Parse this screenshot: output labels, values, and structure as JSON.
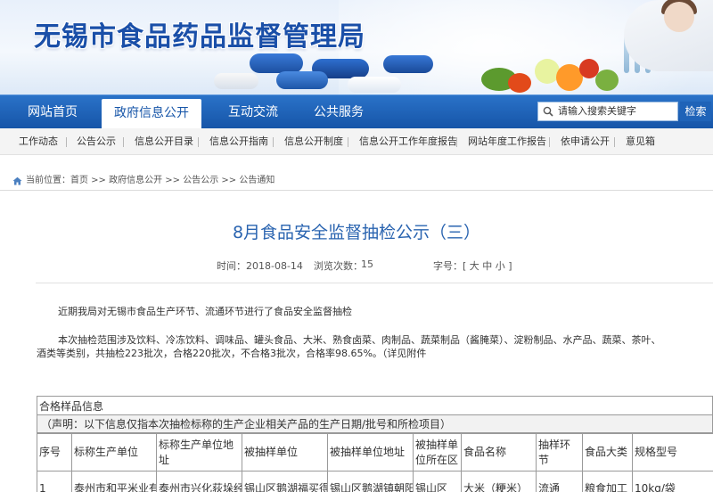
{
  "header": {
    "site_title": "无锡市食品药品监督管理局"
  },
  "nav": {
    "items": [
      "网站首页",
      "政府信息公开",
      "互动交流",
      "公共服务"
    ],
    "active_index": 1
  },
  "search": {
    "placeholder": "请输入搜索关键字",
    "button_label": "检索"
  },
  "subnav": {
    "items": [
      "工作动态",
      "公告公示",
      "信息公开目录",
      "信息公开指南",
      "信息公开制度",
      "信息公开工作年度报告",
      "网站年度工作报告",
      "依申请公开",
      "意见箱"
    ]
  },
  "breadcrumb": {
    "text": "当前位置：首页 >> 政府信息公开 >> 公告公示 >> 公告通知"
  },
  "article": {
    "title": "8月食品安全监督抽检公示（三）",
    "time_label": "时间：2018-08-14",
    "views_label": "浏览次数：",
    "views_value": "15",
    "font_label": "字号：[ 大 中 小 ]",
    "para1": "近期我局对无锡市食品生产环节、流通环节进行了食品安全监督抽检",
    "para2_line1": "本次抽检范围涉及饮料、冷冻饮料、调味品、罐头食品、大米、熟食卤菜、肉制品、蔬菜制品（酱腌菜）、淀粉制品、水产品、蔬菜、茶叶、",
    "para2_line2": "酒类等类别，共抽检223批次，合格220批次，不合格3批次，合格率98.65%。（详见附件"
  },
  "table": {
    "caption": "合格样品信息",
    "note": "（声明：以下信息仅指本次抽检标称的生产企业相关产品的生产日期/批号和所检项目）",
    "columns": [
      "序号",
      "标称生产单位",
      "标称生产单位地址",
      "被抽样单位",
      "被抽样单位地址",
      "被抽样单位所在区",
      "食品名称",
      "抽样环节",
      "食品大类",
      "规格型号"
    ],
    "rows": [
      [
        "1",
        "泰州市和平米业有",
        "泰州市兴化荻垛经",
        "锡山区鹅湖福买得",
        "锡山区鹅湖镇朝阳",
        "锡山区",
        "大米（粳米）",
        "流通",
        "粮食加工",
        "10kg/袋"
      ]
    ]
  }
}
